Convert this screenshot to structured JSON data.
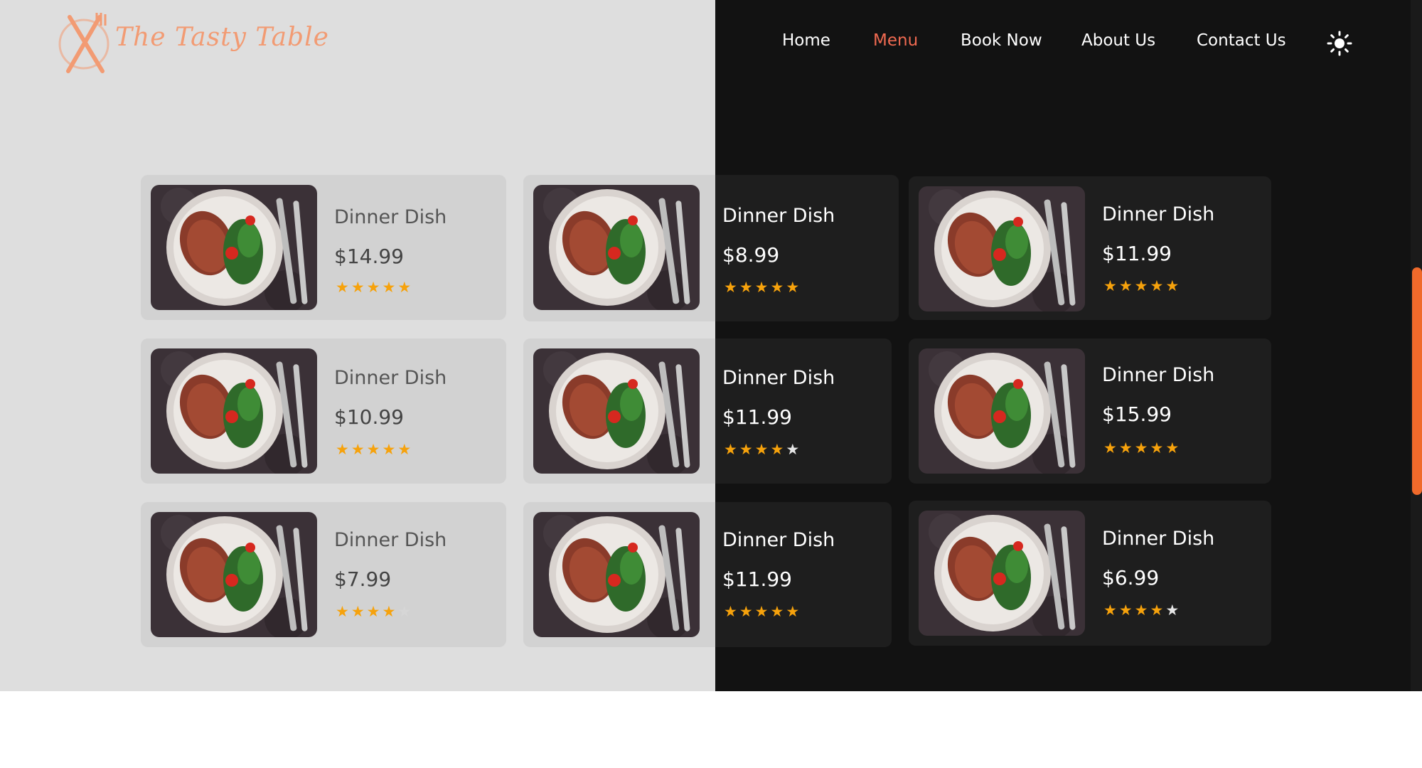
{
  "brand": {
    "logo_text": "The Tasty Table"
  },
  "nav": {
    "items": [
      {
        "label": "Home",
        "active": false
      },
      {
        "label": "Menu",
        "active": true
      },
      {
        "label": "Book Now",
        "active": false
      },
      {
        "label": "About Us",
        "active": false
      },
      {
        "label": "Contact Us",
        "active": false
      }
    ],
    "theme_toggle_icon": "sun-icon"
  },
  "colors": {
    "accent": "#f06a51",
    "brand": "#f29b73",
    "star": "#f6a20c",
    "scrollbar": "#f06a2b",
    "light_bg": "#dedede",
    "dark_bg": "#121212"
  },
  "menu": {
    "cards": [
      {
        "name": "Dinner Dish",
        "price": "$14.99",
        "rating": 5
      },
      {
        "name": "Dinner Dish",
        "price": "$8.99",
        "rating": 5
      },
      {
        "name": "Dinner Dish",
        "price": "$11.99",
        "rating": 5
      },
      {
        "name": "Dinner Dish",
        "price": "$10.99",
        "rating": 5
      },
      {
        "name": "Dinner Dish",
        "price": "$11.99",
        "rating": 4
      },
      {
        "name": "Dinner Dish",
        "price": "$15.99",
        "rating": 5
      },
      {
        "name": "Dinner Dish",
        "price": "$7.99",
        "rating": 4
      },
      {
        "name": "Dinner Dish",
        "price": "$11.99",
        "rating": 5
      },
      {
        "name": "Dinner Dish",
        "price": "$6.99",
        "rating": 4
      }
    ]
  }
}
